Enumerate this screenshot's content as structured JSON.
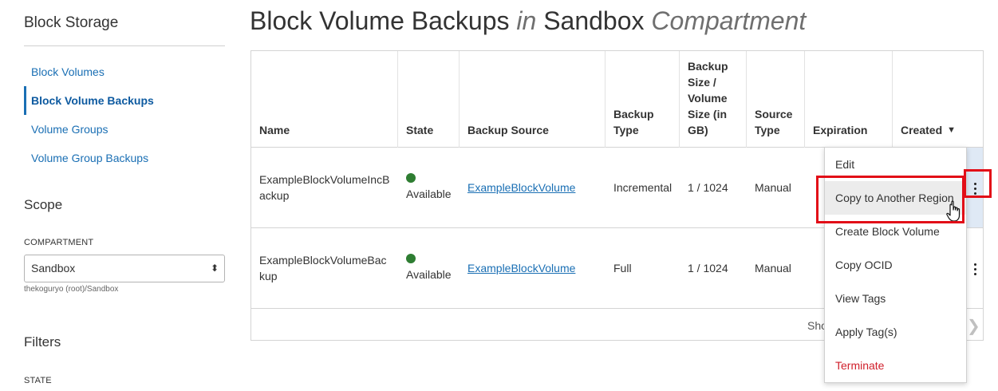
{
  "sidebar": {
    "title": "Block Storage",
    "items": [
      {
        "label": "Block Volumes"
      },
      {
        "label": "Block Volume Backups",
        "active": true
      },
      {
        "label": "Volume Groups"
      },
      {
        "label": "Volume Group Backups"
      }
    ],
    "scope_title": "Scope",
    "compartment_label": "COMPARTMENT",
    "compartment_value": "Sandbox",
    "compartment_path": "thekoguryo (root)/Sandbox",
    "filters_title": "Filters",
    "state_label": "STATE"
  },
  "page": {
    "title_main": "Block Volume Backups",
    "title_in": "in",
    "title_compartment": "Sandbox",
    "title_suffix": "Compartment"
  },
  "table": {
    "headers": {
      "name": "Name",
      "state": "State",
      "backup_source": "Backup Source",
      "backup_type": "Backup Type",
      "backup_size": "Backup Size / Volume Size (in GB)",
      "source_type": "Source Type",
      "expiration": "Expiration",
      "created": "Created"
    },
    "rows": [
      {
        "name": "ExampleBlockVolumeIncBackup",
        "state": "Available",
        "backup_source": "ExampleBlockVolume",
        "backup_type": "Incremental",
        "size": "1 / 1024",
        "source_type": "Manual"
      },
      {
        "name": "ExampleBlockVolumeBackup",
        "state": "Available",
        "backup_source": "ExampleBlockVolume",
        "backup_type": "Full",
        "size": "1 / 1024",
        "source_type": "Manual"
      }
    ],
    "footer_text": "Sho"
  },
  "menu": {
    "items": [
      {
        "label": "Edit"
      },
      {
        "label": "Copy to Another Region"
      },
      {
        "label": "Create Block Volume"
      },
      {
        "label": "Copy OCID"
      },
      {
        "label": "View Tags"
      },
      {
        "label": "Apply Tag(s)"
      },
      {
        "label": "Terminate"
      }
    ]
  },
  "colors": {
    "link": "#1a6fb4",
    "available": "#2e7d32",
    "danger": "#d0202c",
    "highlight": "#e20d17"
  }
}
